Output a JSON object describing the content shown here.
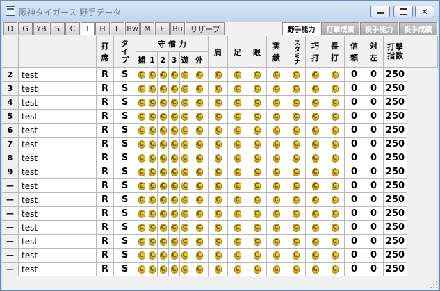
{
  "window": {
    "title": "阪神タイガース 野手データ"
  },
  "tabs": [
    "D",
    "G",
    "YB",
    "S",
    "C",
    "T",
    "H",
    "L",
    "Bw",
    "M",
    "F",
    "Bu",
    "リザーブ"
  ],
  "active_tab": "T",
  "right_buttons": [
    "野手能力",
    "打撃成績",
    "投手能力",
    "投手成績"
  ],
  "headers": {
    "bat": [
      "打",
      "席"
    ],
    "type": [
      "タ",
      "イ",
      "プ"
    ],
    "defense": "守 備 力",
    "def_sub": [
      "捕",
      "1",
      "2",
      "3",
      "遊",
      "外"
    ],
    "shoulder": "肩",
    "speed": "足",
    "eye": "眼",
    "jitsu": [
      "実",
      "績"
    ],
    "stamina": "スタミナ",
    "kou": [
      "巧",
      "打"
    ],
    "chou": [
      "長",
      "打"
    ],
    "trust": [
      "信",
      "頼"
    ],
    "taisa": [
      "対",
      "左"
    ],
    "bat_index": [
      "打",
      "撃",
      "指",
      "数"
    ]
  },
  "rows": [
    {
      "num": "2",
      "name": "test",
      "bat": "R",
      "type": "S",
      "def": [
        "C",
        "C",
        "C",
        "C",
        "C",
        "C"
      ],
      "shoulder": "C",
      "speed": "C",
      "eye": "C",
      "jitsu": "C",
      "stamina": "C",
      "kou": "C",
      "chou": "C",
      "trust": "0",
      "taisa": "0",
      "index": "250"
    },
    {
      "num": "3",
      "name": "test",
      "bat": "R",
      "type": "S",
      "def": [
        "C",
        "C",
        "C",
        "C",
        "C",
        "C"
      ],
      "shoulder": "C",
      "speed": "C",
      "eye": "C",
      "jitsu": "C",
      "stamina": "C",
      "kou": "C",
      "chou": "C",
      "trust": "0",
      "taisa": "0",
      "index": "250"
    },
    {
      "num": "4",
      "name": "test",
      "bat": "R",
      "type": "S",
      "def": [
        "C",
        "C",
        "C",
        "C",
        "C",
        "C"
      ],
      "shoulder": "C",
      "speed": "C",
      "eye": "C",
      "jitsu": "C",
      "stamina": "C",
      "kou": "C",
      "chou": "C",
      "trust": "0",
      "taisa": "0",
      "index": "250"
    },
    {
      "num": "5",
      "name": "test",
      "bat": "R",
      "type": "S",
      "def": [
        "C",
        "C",
        "C",
        "C",
        "C",
        "C"
      ],
      "shoulder": "C",
      "speed": "C",
      "eye": "C",
      "jitsu": "C",
      "stamina": "C",
      "kou": "C",
      "chou": "C",
      "trust": "0",
      "taisa": "0",
      "index": "250"
    },
    {
      "num": "6",
      "name": "test",
      "bat": "R",
      "type": "S",
      "def": [
        "C",
        "C",
        "C",
        "C",
        "C",
        "C"
      ],
      "shoulder": "C",
      "speed": "C",
      "eye": "C",
      "jitsu": "C",
      "stamina": "C",
      "kou": "C",
      "chou": "C",
      "trust": "0",
      "taisa": "0",
      "index": "250"
    },
    {
      "num": "7",
      "name": "test",
      "bat": "R",
      "type": "S",
      "def": [
        "C",
        "C",
        "C",
        "C",
        "C",
        "C"
      ],
      "shoulder": "C",
      "speed": "C",
      "eye": "C",
      "jitsu": "C",
      "stamina": "C",
      "kou": "C",
      "chou": "C",
      "trust": "0",
      "taisa": "0",
      "index": "250"
    },
    {
      "num": "8",
      "name": "test",
      "bat": "R",
      "type": "S",
      "def": [
        "C",
        "C",
        "C",
        "C",
        "C",
        "C"
      ],
      "shoulder": "C",
      "speed": "C",
      "eye": "C",
      "jitsu": "C",
      "stamina": "C",
      "kou": "C",
      "chou": "C",
      "trust": "0",
      "taisa": "0",
      "index": "250"
    },
    {
      "num": "9",
      "name": "test",
      "bat": "R",
      "type": "S",
      "def": [
        "C",
        "C",
        "C",
        "C",
        "C",
        "C"
      ],
      "shoulder": "C",
      "speed": "C",
      "eye": "C",
      "jitsu": "C",
      "stamina": "C",
      "kou": "C",
      "chou": "C",
      "trust": "0",
      "taisa": "0",
      "index": "250"
    },
    {
      "num": "—",
      "name": "test",
      "bat": "R",
      "type": "S",
      "def": [
        "C",
        "C",
        "C",
        "C",
        "C",
        "C"
      ],
      "shoulder": "C",
      "speed": "C",
      "eye": "C",
      "jitsu": "C",
      "stamina": "C",
      "kou": "C",
      "chou": "C",
      "trust": "0",
      "taisa": "0",
      "index": "250"
    },
    {
      "num": "—",
      "name": "test",
      "bat": "R",
      "type": "S",
      "def": [
        "C",
        "C",
        "C",
        "C",
        "C",
        "C"
      ],
      "shoulder": "C",
      "speed": "C",
      "eye": "C",
      "jitsu": "C",
      "stamina": "C",
      "kou": "C",
      "chou": "C",
      "trust": "0",
      "taisa": "0",
      "index": "250"
    },
    {
      "num": "—",
      "name": "test",
      "bat": "R",
      "type": "S",
      "def": [
        "C",
        "C",
        "C",
        "C",
        "C",
        "C"
      ],
      "shoulder": "C",
      "speed": "C",
      "eye": "C",
      "jitsu": "C",
      "stamina": "C",
      "kou": "C",
      "chou": "C",
      "trust": "0",
      "taisa": "0",
      "index": "250"
    },
    {
      "num": "—",
      "name": "test",
      "bat": "R",
      "type": "S",
      "def": [
        "C",
        "C",
        "C",
        "C",
        "C",
        "C"
      ],
      "shoulder": "C",
      "speed": "C",
      "eye": "C",
      "jitsu": "C",
      "stamina": "C",
      "kou": "C",
      "chou": "C",
      "trust": "0",
      "taisa": "0",
      "index": "250"
    },
    {
      "num": "—",
      "name": "test",
      "bat": "R",
      "type": "S",
      "def": [
        "C",
        "C",
        "C",
        "C",
        "C",
        "C"
      ],
      "shoulder": "C",
      "speed": "C",
      "eye": "C",
      "jitsu": "C",
      "stamina": "C",
      "kou": "C",
      "chou": "C",
      "trust": "0",
      "taisa": "0",
      "index": "250"
    },
    {
      "num": "—",
      "name": "test",
      "bat": "R",
      "type": "S",
      "def": [
        "C",
        "C",
        "C",
        "C",
        "C",
        "C"
      ],
      "shoulder": "C",
      "speed": "C",
      "eye": "C",
      "jitsu": "C",
      "stamina": "C",
      "kou": "C",
      "chou": "C",
      "trust": "0",
      "taisa": "0",
      "index": "250"
    },
    {
      "num": "—",
      "name": "test",
      "bat": "R",
      "type": "S",
      "def": [
        "C",
        "C",
        "C",
        "C",
        "C",
        "C"
      ],
      "shoulder": "C",
      "speed": "C",
      "eye": "C",
      "jitsu": "C",
      "stamina": "C",
      "kou": "C",
      "chou": "C",
      "trust": "0",
      "taisa": "0",
      "index": "250"
    }
  ]
}
